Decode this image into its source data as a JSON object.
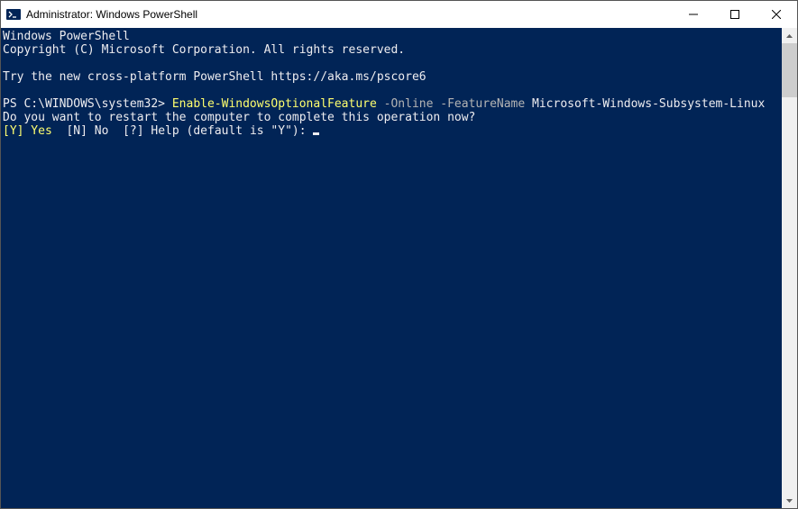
{
  "titlebar": {
    "title": "Administrator: Windows PowerShell"
  },
  "terminal": {
    "header1": "Windows PowerShell",
    "header2": "Copyright (C) Microsoft Corporation. All rights reserved.",
    "tryLine": "Try the new cross-platform PowerShell https://aka.ms/pscore6",
    "prompt": "PS C:\\WINDOWS\\system32> ",
    "command": "Enable-WindowsOptionalFeature",
    "param1": " -Online",
    "param2": " -FeatureName",
    "argValue": " Microsoft-Windows-Subsystem-Linux",
    "restartQuestion": "Do you want to restart the computer to complete this operation now?",
    "optYes": "[Y] Yes ",
    "optNo": " [N] No ",
    "optHelp": " [?] Help (default is \"Y\"): "
  }
}
